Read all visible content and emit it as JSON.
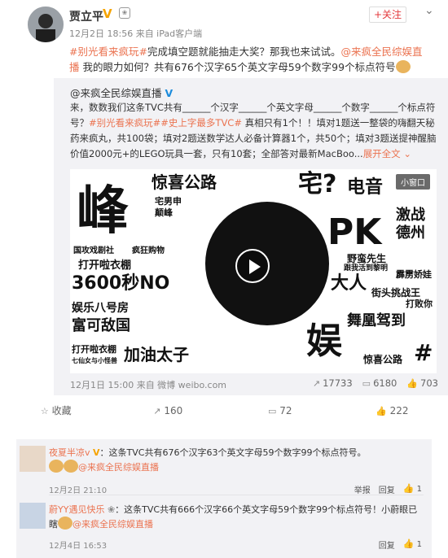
{
  "post": {
    "author_name": "贾立平",
    "verified_badge": "V",
    "follow_label": "+关注",
    "meta": "12月2日 18:56 来自 iPad客户端",
    "text_topic": "#别光看来疯玩#",
    "text_a": "完成填空题就能抽走大奖？那我也来试试。",
    "text_at": "@来疯全民综娱直播",
    "text_b": " 我的眼力如何？共有676个汉字65个英文字母59个数字99个标点符号"
  },
  "repost": {
    "author": "@来疯全民综娱直播",
    "verified_badge": "V",
    "line1": "来，数数我们这条TVC共有______个汉字______个英文字母______个数字______个标点符号？",
    "topic1": "#别光看来疯玩#",
    "topic2": "#史上字最多TVC#",
    "line2": " 真相只有1个！！填对1题送一整袋的嗨翻天秘药来疯丸，共100袋；填对2题送数学达人必备计算器1个，共50个；填对3题送提神醒脑价值2000元+的LEGO玩具一套，只有10套；全部答对最新MacBoo...",
    "more_label": "展开全文",
    "video_mini_label": "小窗口",
    "video_words": [
      "峰",
      "惊喜公路",
      "宅?",
      "电音",
      "PK",
      "激战",
      "德州",
      "宅男申",
      "颠峰",
      "国攻戏剧社",
      "疯狂购物",
      "打开啦衣棚",
      "3600秒NO",
      "娱乐八号房",
      "富可敌国",
      "打开啦衣棚",
      "七仙女与小怪兽",
      "加油太子",
      "大人",
      "街头挑战王",
      "舞凰驾到",
      "惊喜公路",
      "娱",
      "#",
      "野蛮先生",
      "跟我活到黎明",
      "霹雳娇娃",
      "打败你"
    ],
    "meta": "12月1日 15:00 来自 微博 weibo.com",
    "repost_count": "17733",
    "comment_count": "6180",
    "like_count": "703"
  },
  "actions": {
    "favorite_label": "收藏",
    "repost_count": "160",
    "comment_count": "72",
    "like_count": "222"
  },
  "comments": [
    {
      "nick": "夜夏半凉v",
      "badge": "V",
      "text": "：这条TVC共有676个汉字63个英文字母59个数字99个标点符号。",
      "at": "@来疯全民综娱直播",
      "time": "12月2日 21:10",
      "report_label": "举报",
      "reply_label": "回复",
      "like_count": "1"
    },
    {
      "nick": "蔚YY遇见快乐",
      "badge": "",
      "text": "：这条TVC共有666个汉字66个英文字母59个数字99个标点符号！小蔚眼已瞎",
      "at": "@来疯全民综娱直播",
      "time": "12月4日 16:53",
      "report_label": "",
      "reply_label": "回复",
      "like_count": "1"
    }
  ]
}
